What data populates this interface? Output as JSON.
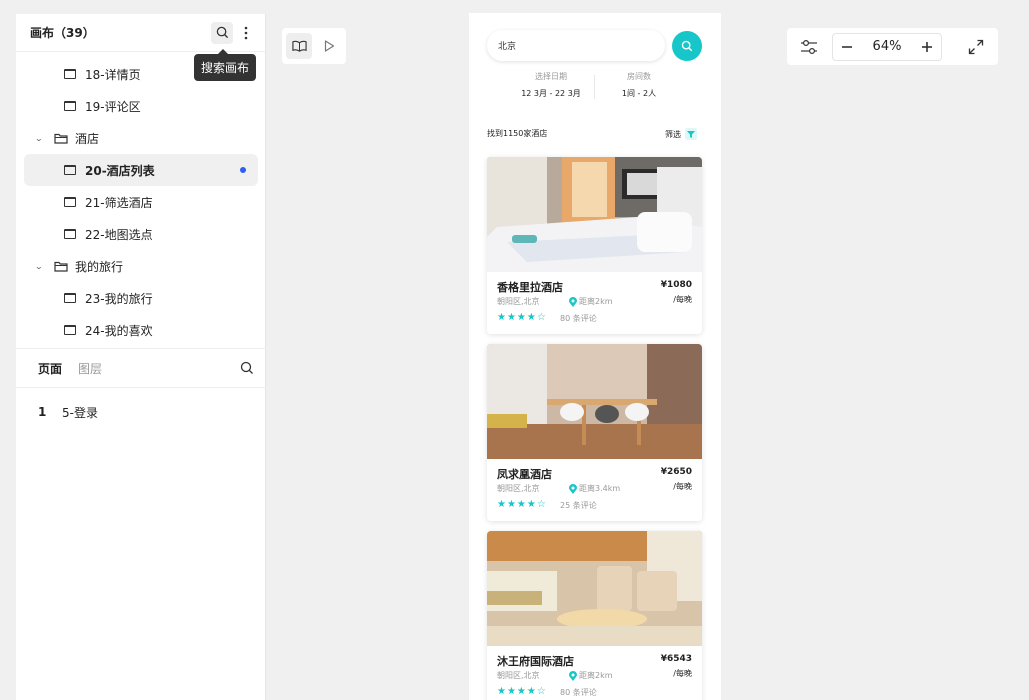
{
  "left_panel": {
    "title": "画布（39）",
    "search_tooltip": "搜索画布",
    "tree": [
      {
        "type": "page",
        "label": "18-详情页"
      },
      {
        "type": "page",
        "label": "19-评论区"
      },
      {
        "type": "folder",
        "label": "酒店"
      },
      {
        "type": "page",
        "label": "20-酒店列表",
        "active": true
      },
      {
        "type": "page",
        "label": "21-筛选酒店"
      },
      {
        "type": "page",
        "label": "22-地图选点"
      },
      {
        "type": "folder",
        "label": "我的旅行"
      },
      {
        "type": "page",
        "label": "23-我的旅行"
      },
      {
        "type": "page",
        "label": "24-我的喜欢"
      }
    ],
    "tabs": {
      "pages": "页面",
      "layers": "图层"
    },
    "page_list": [
      {
        "num": "1",
        "label": "5-登录"
      }
    ]
  },
  "zoom": {
    "value": "64%"
  },
  "phone": {
    "search_value": "北京",
    "date_label": "选择日期",
    "date_value": "12 3月 - 22 3月",
    "room_label": "房间数",
    "room_value": "1间 - 2人",
    "found_text": "找到1150家酒店",
    "filter_text": "筛选",
    "hotels": [
      {
        "name": "香格里拉酒店",
        "price": "¥1080",
        "unit": "/每晚",
        "area": "朝阳区,北京",
        "distance": "距离2km",
        "stars": "★★★★☆",
        "reviews": "80 条评论"
      },
      {
        "name": "凤求凰酒店",
        "price": "¥2650",
        "unit": "/每晚",
        "area": "朝阳区,北京",
        "distance": "距离3.4km",
        "stars": "★★★★☆",
        "reviews": "25 条评论"
      },
      {
        "name": "沐王府国际酒店",
        "price": "¥6543",
        "unit": "/每晚",
        "area": "朝阳区,北京",
        "distance": "距离2km",
        "stars": "★★★★☆",
        "reviews": "80 条评论"
      }
    ]
  },
  "colors": {
    "accent": "#16c6c8",
    "active_dot": "#2f5ef0"
  }
}
